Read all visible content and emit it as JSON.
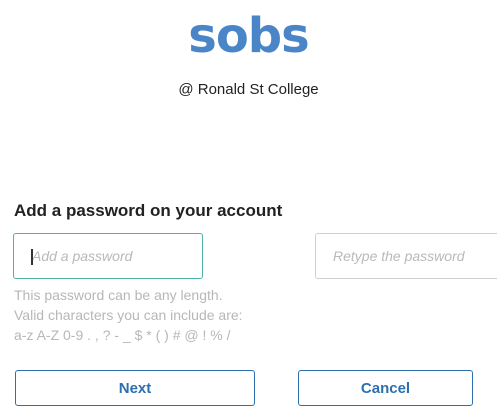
{
  "brand": {
    "logo_text": "sobs",
    "school_name": "@ Ronald St College"
  },
  "colors": {
    "brand_blue": "#4a86c7",
    "button_text": "#2d6faf",
    "active_border": "#4fb3a8",
    "hint_text": "#b7b7b7"
  },
  "form": {
    "title": "Add a password on your account",
    "password_placeholder": "Add a password",
    "retype_placeholder": "Retype the password",
    "hint_line_1": "This password can be any length.",
    "hint_line_2": "Valid characters you can include are:",
    "hint_line_3": "a-z A-Z 0-9 . , ? - _ $ * ( ) # @ ! % /"
  },
  "actions": {
    "next_label": "Next",
    "cancel_label": "Cancel"
  }
}
